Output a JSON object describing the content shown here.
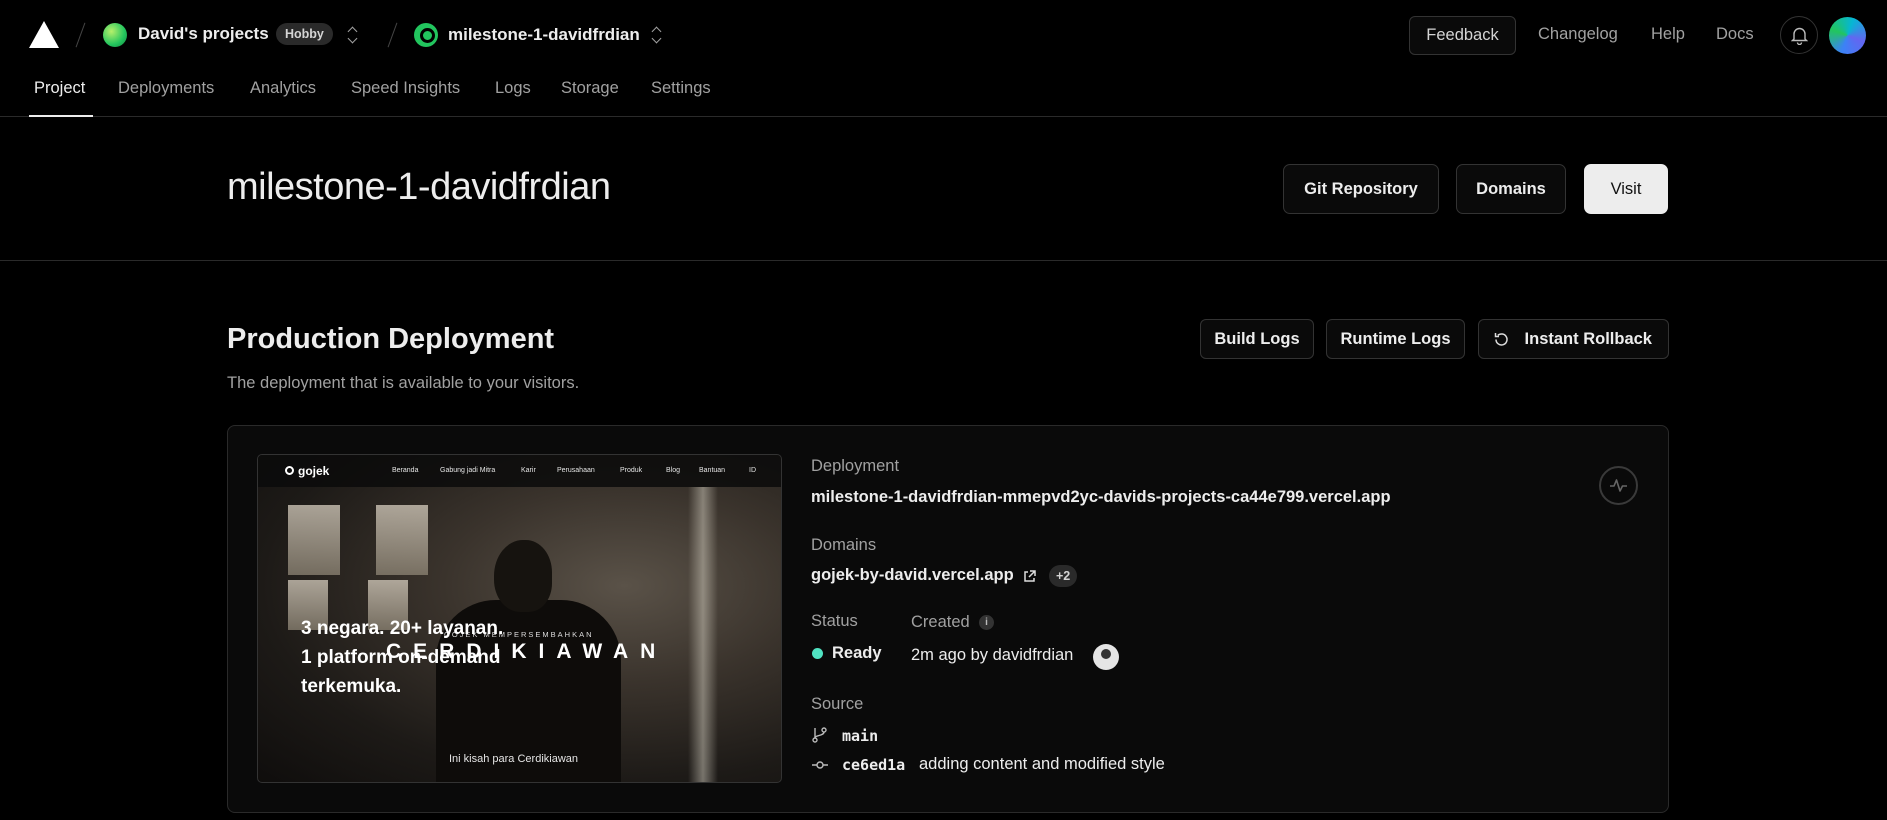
{
  "header": {
    "team_name": "David's projects",
    "plan_badge": "Hobby",
    "project_name": "milestone-1-davidfrdian",
    "feedback_label": "Feedback",
    "links": [
      "Changelog",
      "Help",
      "Docs"
    ]
  },
  "tabs": [
    "Project",
    "Deployments",
    "Analytics",
    "Speed Insights",
    "Logs",
    "Storage",
    "Settings"
  ],
  "active_tab": "Project",
  "project_header": {
    "title": "milestone-1-davidfrdian",
    "buttons": {
      "git": "Git Repository",
      "domains": "Domains",
      "visit": "Visit"
    }
  },
  "production": {
    "title": "Production Deployment",
    "subtitle": "The deployment that is available to your visitors.",
    "buttons": {
      "build_logs": "Build Logs",
      "runtime_logs": "Runtime Logs",
      "rollback": "Instant Rollback"
    },
    "preview": {
      "logo": "gojek",
      "nav": [
        "Beranda",
        "Gabung jadi Mitra",
        "Karir",
        "Perusahaan",
        "Produk",
        "Blog",
        "Bantuan",
        "ID"
      ],
      "headline": "3 negara. 20+ layanan. 1 platform on-demand terkemuka.",
      "overlay_small": "GOJEK MEMPERSEMBAHKAN",
      "overlay_big": "CERDIKIAWAN",
      "caption": "Ini kisah para Cerdikiawan"
    },
    "deployment": {
      "label": "Deployment",
      "url": "milestone-1-davidfrdian-mmepvd2yc-davids-projects-ca44e799.vercel.app"
    },
    "domains": {
      "label": "Domains",
      "primary": "gojek-by-david.vercel.app",
      "extra_count": "+2"
    },
    "status": {
      "label": "Status",
      "value": "Ready",
      "color": "#50e3c2"
    },
    "created": {
      "label": "Created",
      "value": "2m ago by davidfrdian"
    },
    "source": {
      "label": "Source",
      "branch": "main",
      "commit_hash": "ce6ed1a",
      "commit_message": "adding content and modified style"
    }
  }
}
